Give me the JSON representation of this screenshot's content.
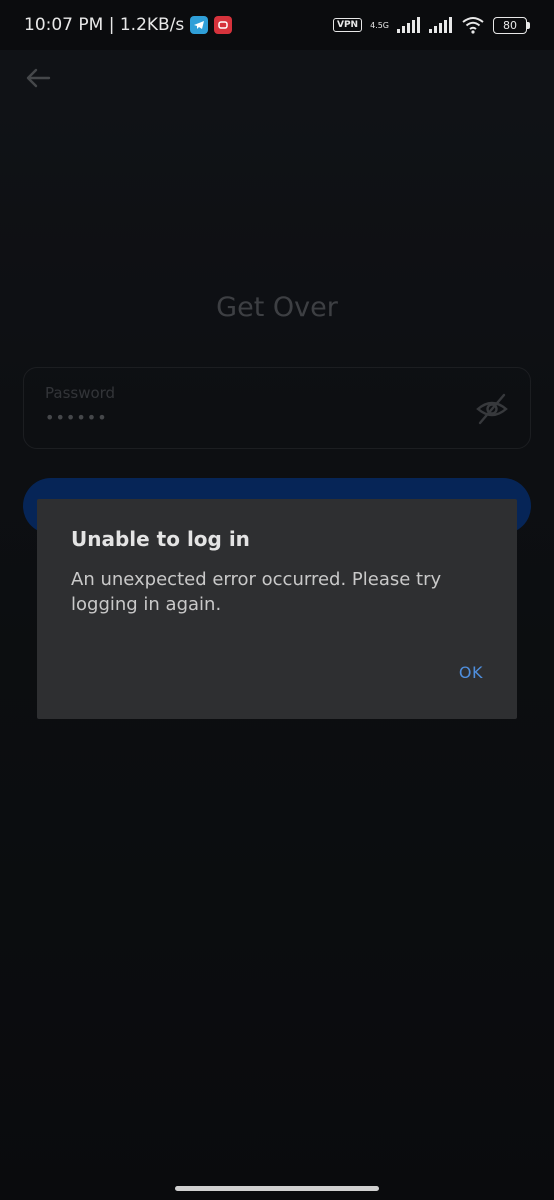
{
  "status_bar": {
    "time_speed": "10:07 PM | 1.2KB/s",
    "vpn": "VPN",
    "network_type": "4.5G",
    "battery": "80"
  },
  "page": {
    "title": "Get Over",
    "password_label": "Password",
    "password_value": "••••••"
  },
  "dialog": {
    "title": "Unable to log in",
    "message": "An unexpected error occurred. Please try logging in again.",
    "ok_label": "OK"
  },
  "colors": {
    "accent": "#4f8fde",
    "button": "#0a3a86",
    "dialog_bg": "#2e2f31"
  }
}
